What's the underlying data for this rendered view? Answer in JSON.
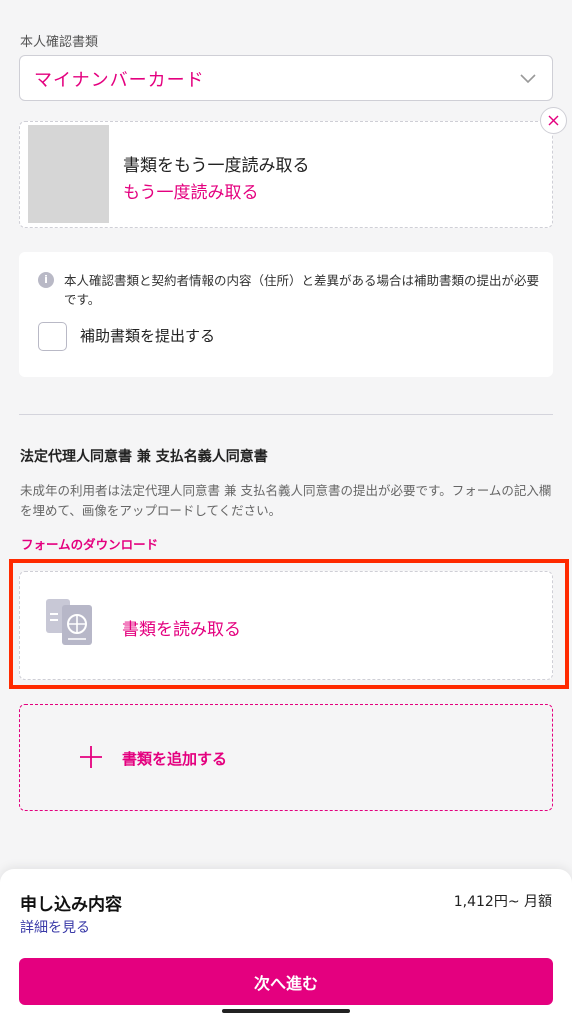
{
  "document_type": {
    "label": "本人確認書類",
    "selected": "マイナンバーカード"
  },
  "scanned_document": {
    "title": "書類をもう一度読み取る",
    "rescan_link": "もう一度読み取る"
  },
  "notice": {
    "text": "本人確認書類と契約者情報の内容（住所）と差異がある場合は補助書類の提出が必要です。",
    "checkbox_label": "補助書類を提出する"
  },
  "guardian_consent": {
    "title": "法定代理人同意書 兼 支払名義人同意書",
    "description": "未成年の利用者は法定代理人同意書 兼 支払名義人同意書の提出が必要です。フォームの記入欄を埋めて、画像をアップロードしてください。",
    "download_link": "フォームのダウンロード",
    "read_button": "書類を読み取る",
    "add_button": "書類を追加する"
  },
  "summary": {
    "title": "申し込み内容",
    "price": "1,412円~ 月額",
    "details_link": "詳細を見る",
    "next_button": "次へ進む"
  },
  "colors": {
    "accent": "#e4007f",
    "highlight": "#ff2a00",
    "background": "#f5f5f6"
  },
  "icons": [
    "chevron-down-icon",
    "close-icon",
    "info-icon",
    "document-scan-icon",
    "plus-icon"
  ]
}
